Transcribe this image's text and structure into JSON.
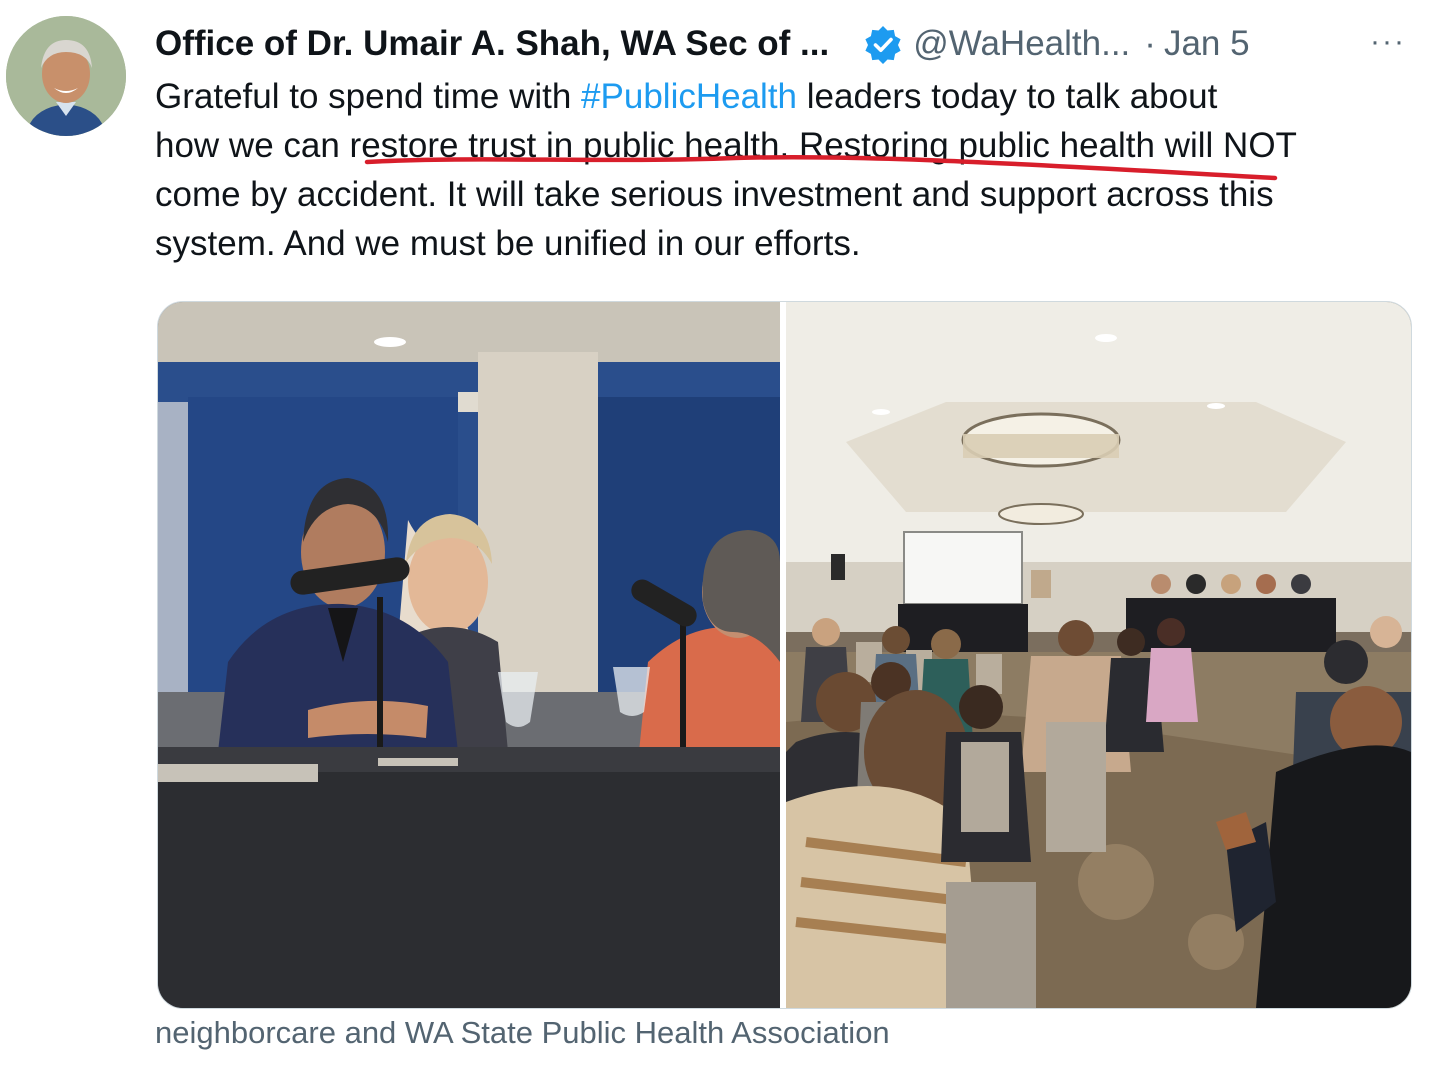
{
  "tweet": {
    "display_name": "Office of Dr. Umair A. Shah, WA Sec of ...",
    "handle": "@WaHealth...",
    "separator": "·",
    "date": "Jan 5",
    "more_label": "···",
    "text": {
      "line1_a": "Grateful to spend time with ",
      "line1_hashtag": "#PublicHealth",
      "line1_b": " leaders today to talk about",
      "line2": "how we can restore trust in public health. Restoring public health will NOT",
      "line3": "come by accident. It will take serious investment and support across this",
      "line4": "system. And we must be unified in our efforts."
    },
    "media_caption": "neighborcare and WA State Public Health Association"
  },
  "icons": {
    "verified": "verified-badge-icon",
    "more": "more-options-icon"
  },
  "colors": {
    "link": "#1d9bf0",
    "secondary_text": "#536471",
    "verified_badge": "#1d9bf0",
    "annotation_underline": "#d81e2b"
  }
}
